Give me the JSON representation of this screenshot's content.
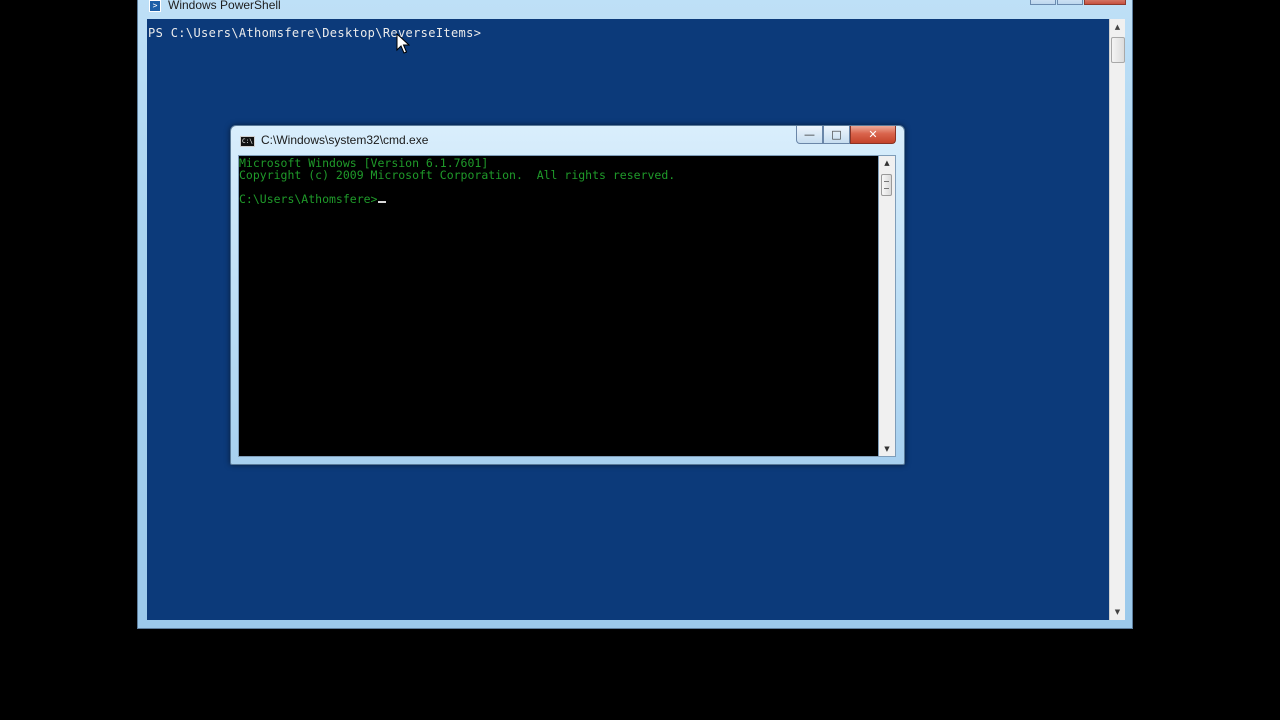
{
  "powershell": {
    "title": "Windows PowerShell",
    "prompt_line": "PS C:\\Users\\Athomsfere\\Desktop\\ReverseItems>",
    "console_bg": "#0c3a7a",
    "text_color": "#ececec"
  },
  "cmd": {
    "title": "C:\\Windows\\system32\\cmd.exe",
    "icon_label": "C:\\",
    "lines": [
      "Microsoft Windows [Version 6.1.7601]",
      "Copyright (c) 2009 Microsoft Corporation.  All rights reserved.",
      "",
      "C:\\Users\\Athomsfere>"
    ],
    "text_color": "#1f9a2a",
    "controls": {
      "minimize": "—",
      "maximize": "□",
      "close": "✕"
    }
  },
  "icons": {
    "powershell_window_icon": "powershell-icon",
    "cmd_window_icon": "cmd-icon",
    "mouse_pointer": "mouse-cursor-icon",
    "scroll_up": "▲",
    "scroll_down": "▼"
  }
}
